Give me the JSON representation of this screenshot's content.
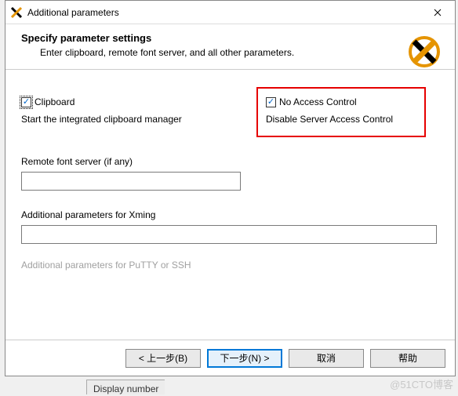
{
  "window": {
    "title": "Additional parameters"
  },
  "header": {
    "heading": "Specify parameter settings",
    "subtitle": "Enter clipboard, remote font server, and all other parameters."
  },
  "clipboard": {
    "label": "Clipboard",
    "checked": true,
    "desc": "Start the integrated clipboard manager"
  },
  "access": {
    "label": "No Access Control",
    "checked": true,
    "desc": "Disable Server Access Control"
  },
  "remote_font": {
    "label": "Remote font server (if any)",
    "value": ""
  },
  "xming_params": {
    "label": "Additional parameters for Xming",
    "value": ""
  },
  "putty_params": {
    "label": "Additional parameters for PuTTY or SSH"
  },
  "buttons": {
    "back": "< 上一步(B)",
    "next": "下一步(N) >",
    "cancel": "取消",
    "help": "帮助"
  },
  "background_fragment": "Display number",
  "watermark": "@51CTO博客"
}
